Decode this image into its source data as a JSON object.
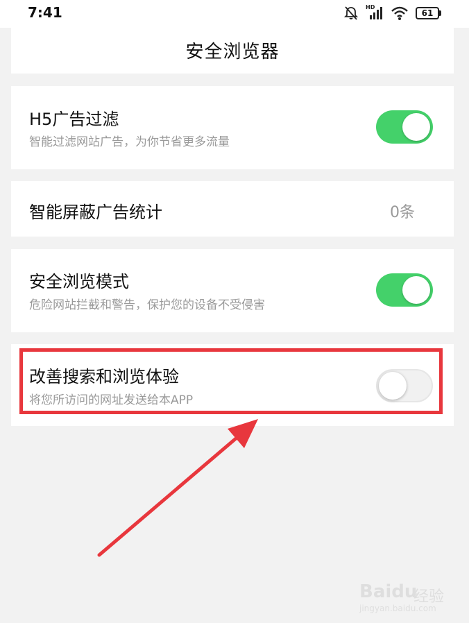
{
  "status_bar": {
    "time": "7:41",
    "battery": "61",
    "hd_label": "HD"
  },
  "header": {
    "title": "安全浏览器"
  },
  "settings": {
    "h5_filter": {
      "title": "H5广告过滤",
      "subtitle": "智能过滤网站广告，为你节省更多流量",
      "enabled": true
    },
    "ad_block_stats": {
      "title": "智能屏蔽广告统计",
      "value": "0条"
    },
    "safe_mode": {
      "title": "安全浏览模式",
      "subtitle": "危险网站拦截和警告，保护您的设备不受侵害",
      "enabled": true
    },
    "improve_experience": {
      "title": "改善搜索和浏览体验",
      "subtitle": "将您所访问的网址发送给本APP",
      "enabled": false
    }
  },
  "watermark": {
    "logo": "Baidu",
    "brand": "经验",
    "url": "jingyan.baidu.com"
  },
  "colors": {
    "toggle_on": "#44d16a",
    "highlight": "#e8373d",
    "background": "#f2f2f2"
  }
}
